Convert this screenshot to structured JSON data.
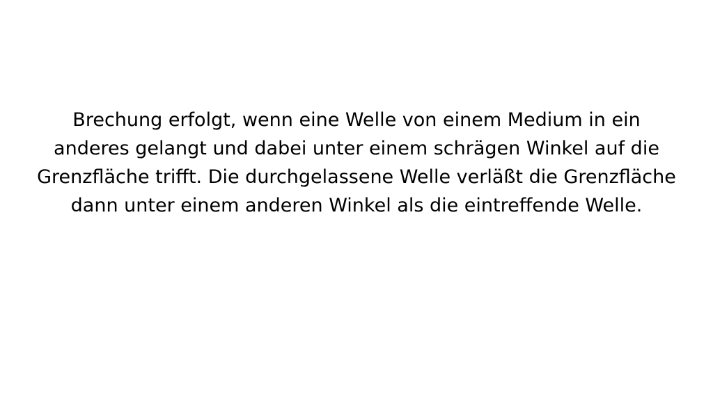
{
  "document": {
    "lines": [
      "Brechung erfolgt, wenn eine Welle von einem Medium in ein",
      "anderes gelangt und dabei unter einem schrägen Winkel auf die",
      "Grenzfläche trifft. Die durchgelassene Welle verläßt die Grenzfläche",
      "dann unter einem anderen Winkel als die eintreffende Welle."
    ],
    "text_color": "#000000",
    "background_color": "#ffffff"
  }
}
